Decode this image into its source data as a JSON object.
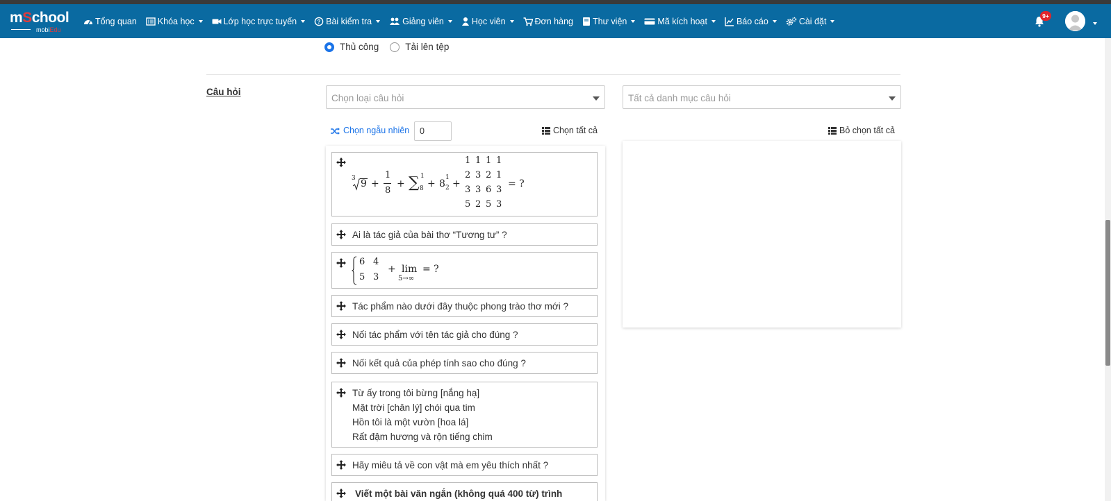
{
  "navbar": {
    "logo_main_a": "m",
    "logo_main_accent": "S",
    "logo_main_b": "chool",
    "logo_sub_a": "mobi",
    "logo_sub_accent": "Edu",
    "items": [
      {
        "label": "Tổng quan",
        "icon": "dashboard-icon",
        "dropdown": false
      },
      {
        "label": "Khóa học",
        "icon": "list-alt-icon",
        "dropdown": true
      },
      {
        "label": "Lớp học trực tuyến",
        "icon": "video-camera-icon",
        "dropdown": true
      },
      {
        "label": "Bài kiểm tra",
        "icon": "question-circle-icon",
        "dropdown": true
      },
      {
        "label": "Giảng viên",
        "icon": "users-icon",
        "dropdown": true
      },
      {
        "label": "Học viên",
        "icon": "user-icon",
        "dropdown": true
      },
      {
        "label": "Đơn hàng",
        "icon": "shopping-cart-icon",
        "dropdown": false
      },
      {
        "label": "Thư viện",
        "icon": "book-icon",
        "dropdown": true
      },
      {
        "label": "Mã kích hoạt",
        "icon": "credit-card-icon",
        "dropdown": true
      },
      {
        "label": "Báo cáo",
        "icon": "line-chart-icon",
        "dropdown": true
      },
      {
        "label": "Cài đặt",
        "icon": "cogs-icon",
        "dropdown": true
      }
    ],
    "notification_badge": "9+"
  },
  "input_mode": {
    "options": [
      {
        "label": "Thủ công",
        "checked": true
      },
      {
        "label": "Tải lên tệp",
        "checked": false
      }
    ]
  },
  "questions_section": {
    "label": "Câu hỏi",
    "type_select_placeholder": "Chọn loại câu hỏi",
    "category_select_placeholder": "Tất cả danh mục câu hỏi",
    "random_label": "Chọn ngẫu nhiên",
    "random_value": "0",
    "select_all_label": "Chọn tất cả",
    "deselect_all_label": "Bỏ chọn tất cả"
  },
  "question_list": {
    "math1": {
      "root_index": "3",
      "root_radicand": "9",
      "frac_num": "1",
      "frac_den": "8",
      "sum_symbol": "∑",
      "sum_upper": "1",
      "sum_lower": "8",
      "base": "8",
      "sup": "1",
      "sub": "2",
      "plus": "+",
      "matrix": [
        [
          "1",
          "1",
          "1",
          "1"
        ],
        [
          "2",
          "3",
          "2",
          "1"
        ],
        [
          "3",
          "3",
          "6",
          "3"
        ],
        [
          "5",
          "2",
          "5",
          "3"
        ]
      ],
      "tail": "= ?"
    },
    "q2": "Ai là tác giả của bài thơ “Tương tư” ?",
    "math2": {
      "system": [
        [
          "6",
          "4"
        ],
        [
          "5",
          "3"
        ]
      ],
      "plus": "+",
      "lim": "lim",
      "lim_sub": "5→∞",
      "tail": "= ?"
    },
    "q4": "Tác phẩm nào dưới đây thuộc phong trào thơ mới ?",
    "q5": "Nối tác phẩm với tên tác giả cho đúng ?",
    "q6": "Nối kết quả của phép tính sao cho đúng ?",
    "q7": [
      "Từ ấy trong tôi bừng [nắng hạ]",
      "Mặt trời [chân lý] chói qua tim",
      "Hồn tôi là một vườn [hoa lá]",
      "Rất đậm hương và rộn tiếng chim"
    ],
    "q8": "Hãy miêu tả về con vật mà em yêu thích nhất ?",
    "q9": "Viết một bài văn ngắn (không quá 400 từ) trình"
  },
  "colors": {
    "navbar": "#0a6aa1",
    "accent": "#1a73e8",
    "logo_accent": "#e23b3b",
    "badge": "#e0262b"
  }
}
